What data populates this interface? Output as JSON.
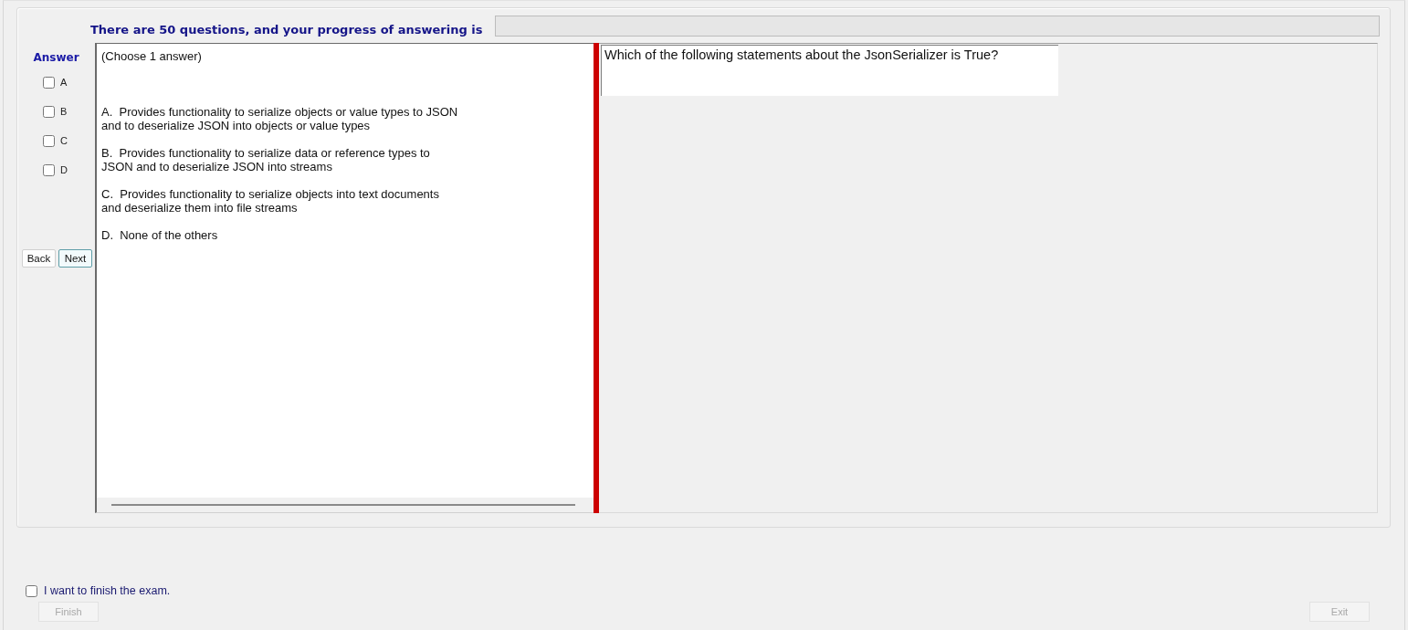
{
  "header": {
    "text": "There are 50 questions, and your progress of answering is",
    "progress": {
      "level": 0
    }
  },
  "answer_panel": {
    "title": "Answer",
    "options": [
      {
        "label": "A",
        "checked": false
      },
      {
        "label": "B",
        "checked": false
      },
      {
        "label": "C",
        "checked": false
      },
      {
        "label": "D",
        "checked": false
      }
    ],
    "buttons": [
      {
        "label": "Back",
        "focused": false
      },
      {
        "label": "Next",
        "focused": true
      }
    ]
  },
  "options_panel": {
    "instruction": "(Choose 1 answer)",
    "options": [
      "A.  Provides functionality to serialize objects or value types to JSON\nand to deserialize JSON into objects or value types",
      "B.  Provides functionality to serialize data or reference types to\nJSON and to deserialize JSON into streams",
      "C.  Provides functionality to serialize objects into text documents\nand deserialize them into file streams",
      "D.  None of the others"
    ]
  },
  "question": {
    "text": "Which of the following statements about the JsonSerializer is True?"
  },
  "footer": {
    "finish_checkbox": {
      "label": "I want to finish the exam.",
      "checked": false
    },
    "finish_button": {
      "label": "Finish",
      "disabled": true
    },
    "exit_button": {
      "label": "Exit",
      "disabled": true
    }
  }
}
